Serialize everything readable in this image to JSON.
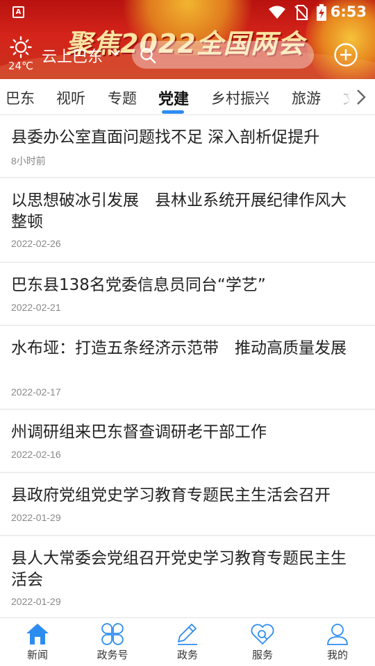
{
  "status_bar": {
    "time": "6:53",
    "app_icon_letter": "A"
  },
  "header": {
    "banner_text": "聚焦2022全国两会",
    "weather_temp": "24℃",
    "weather_icon": "sun-icon",
    "location": "云上巴东",
    "search_placeholder": "",
    "add_icon": "plus-circle-icon"
  },
  "tabs": [
    {
      "label": "巴东"
    },
    {
      "label": "视听"
    },
    {
      "label": "专题"
    },
    {
      "label": "党建",
      "active": true
    },
    {
      "label": "乡村振兴"
    },
    {
      "label": "旅游"
    },
    {
      "label": "文"
    }
  ],
  "articles": [
    {
      "title": "县委办公室直面问题找不足 深入剖析促提升",
      "date": "8小时前"
    },
    {
      "title": "以思想破冰引发展　县林业系统开展纪律作风大整顿",
      "date": "2022-02-26"
    },
    {
      "title": "巴东县138名党委信息员同台“学艺”",
      "date": "2022-02-21"
    },
    {
      "title": "水布垭：打造五条经济示范带　推动高质量发展",
      "date": "2022-02-17"
    },
    {
      "title": "州调研组来巴东督查调研老干部工作",
      "date": "2022-02-16"
    },
    {
      "title": "县政府党组党史学习教育专题民主生活会召开",
      "date": "2022-01-29"
    },
    {
      "title": "县人大常委会党组召开党史学习教育专题民主生活会",
      "date": "2022-01-29"
    }
  ],
  "bottom_nav": [
    {
      "label": "新闻",
      "icon": "home-icon",
      "active": true
    },
    {
      "label": "政务号",
      "icon": "clover-icon"
    },
    {
      "label": "政务",
      "icon": "pen-icon"
    },
    {
      "label": "服务",
      "icon": "heart-search-icon"
    },
    {
      "label": "我的",
      "icon": "user-icon"
    }
  ],
  "colors": {
    "accent": "#2d8cf0",
    "header_red": "#c8231a",
    "banner_gold": "#fbe3a2"
  }
}
